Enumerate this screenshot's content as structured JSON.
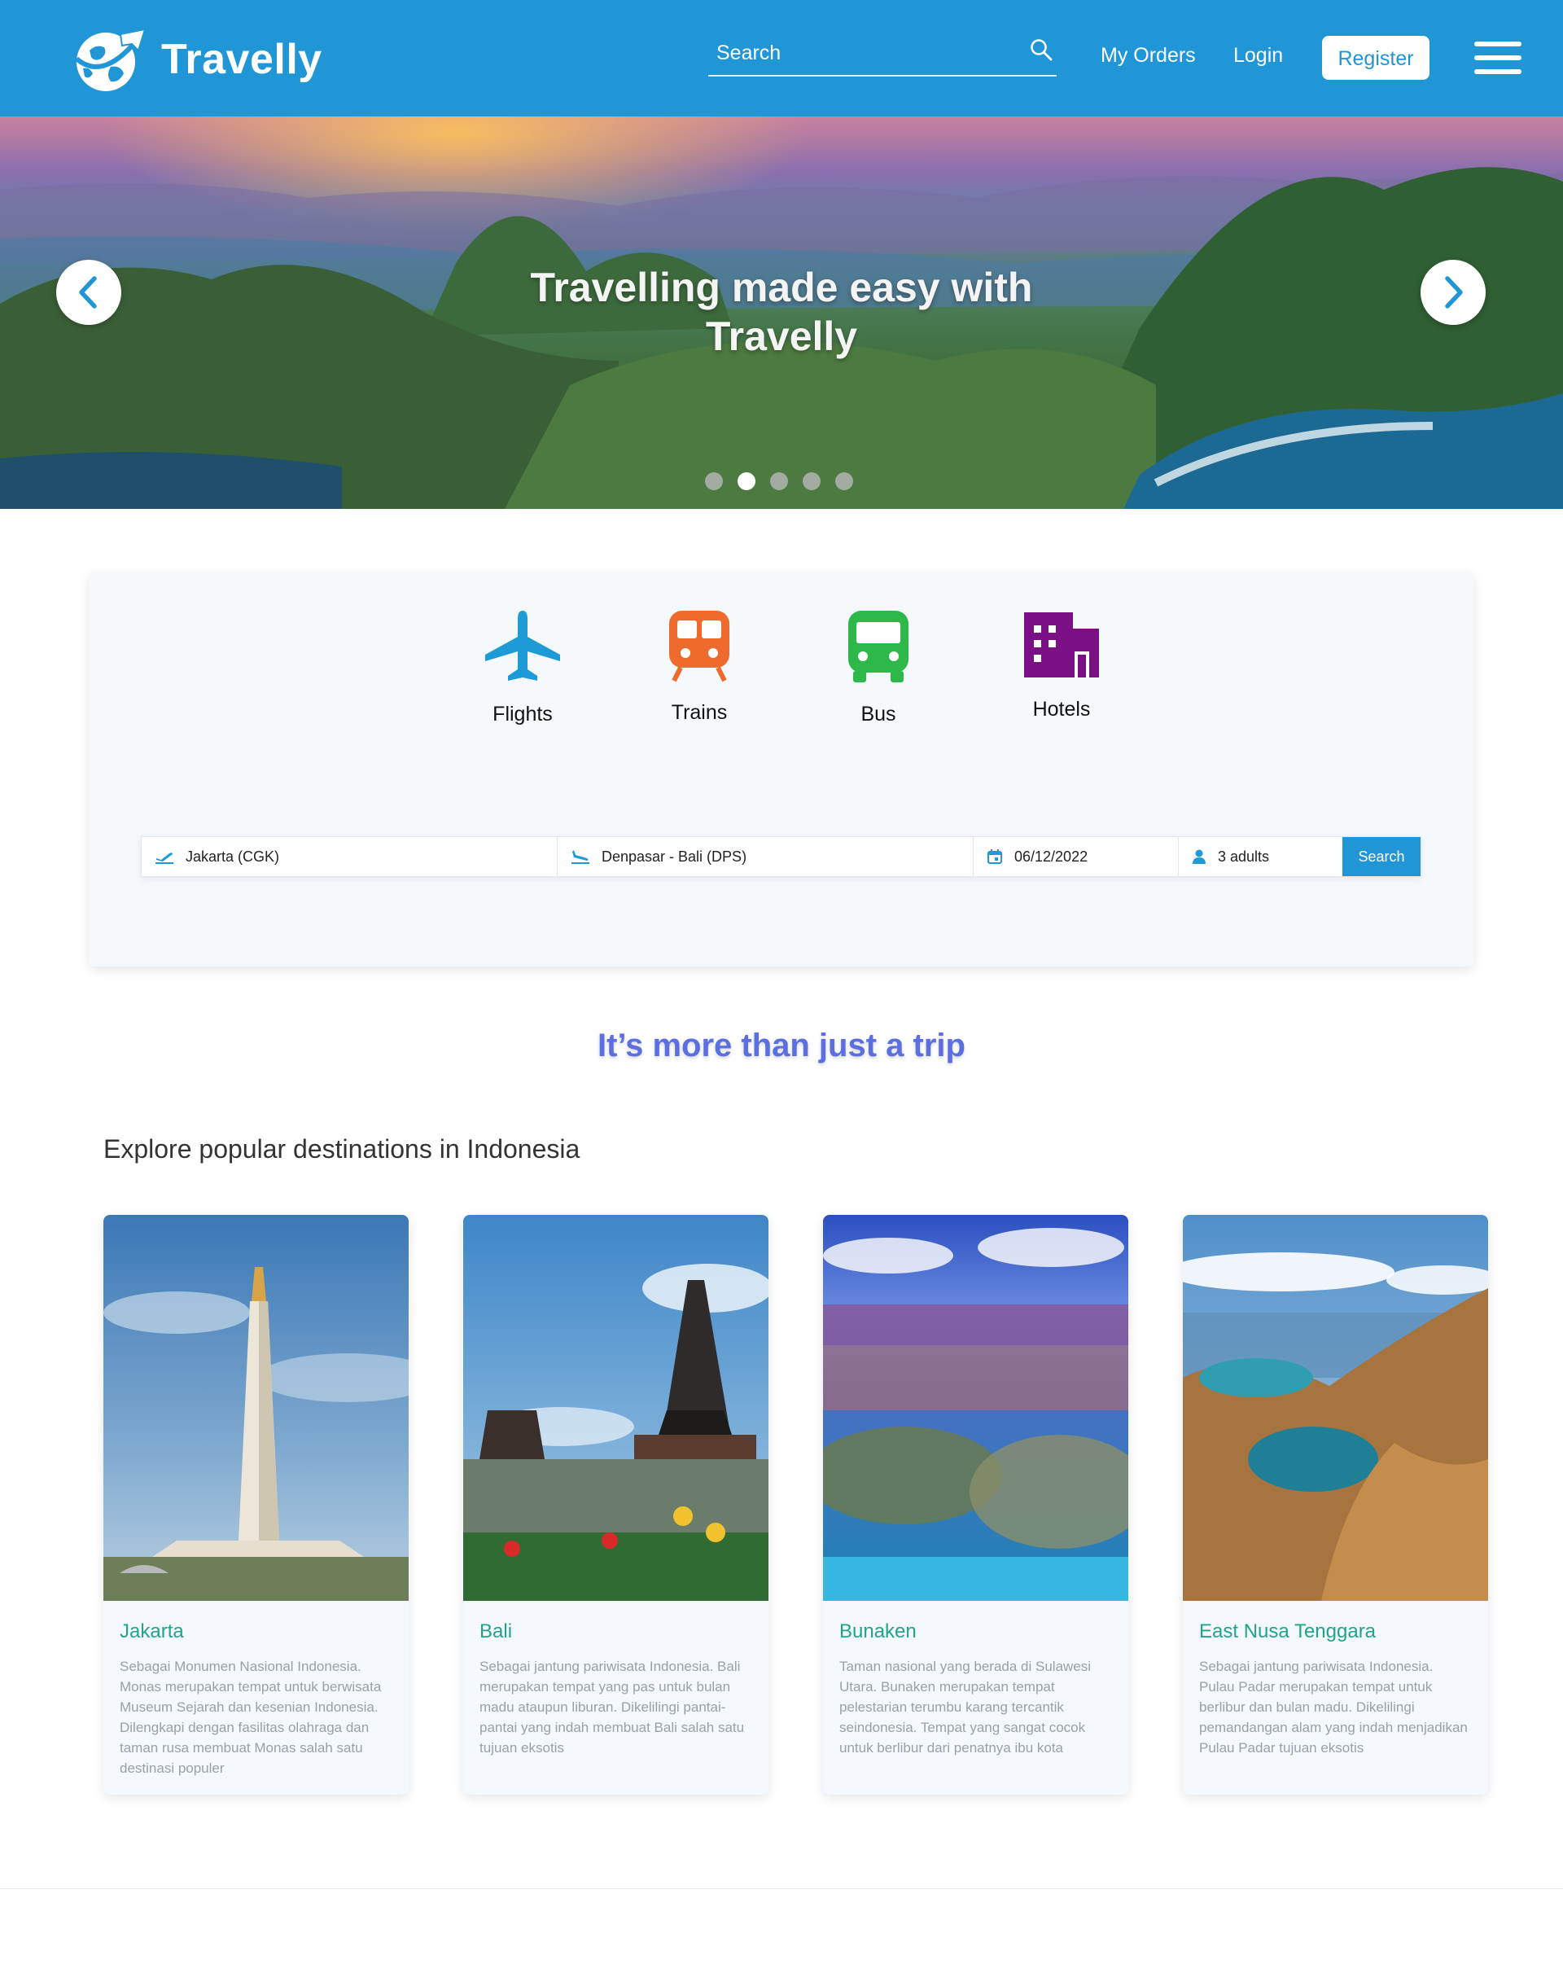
{
  "header": {
    "brand": "Travelly",
    "search_placeholder": "Search",
    "nav": {
      "orders": "My Orders",
      "login": "Login",
      "register": "Register"
    },
    "color": "#2196d6"
  },
  "hero": {
    "title": "Travelling made easy with Travelly",
    "slide_count": 5,
    "active_slide": 2
  },
  "modes": {
    "flights": "Flights",
    "trains": "Trains",
    "bus": "Bus",
    "hotels": "Hotels"
  },
  "booking": {
    "from": "Jakarta (CGK)",
    "to": "Denpasar - Bali (DPS)",
    "date": "06/12/2022",
    "passengers": "3 adults",
    "search_label": "Search"
  },
  "tagline": "It’s more than just a trip",
  "section_title": "Explore popular destinations in Indonesia",
  "destinations": [
    {
      "name": "Jakarta",
      "desc": "Sebagai Monumen Nasional Indonesia. Monas merupakan tempat untuk berwisata Museum Sejarah dan kesenian Indonesia. Dilengkapi dengan fasilitas olahraga dan taman rusa membuat Monas salah satu destinasi populer"
    },
    {
      "name": "Bali",
      "desc": "Sebagai jantung pariwisata Indonesia. Bali merupakan tempat yang pas untuk bulan madu ataupun liburan. Dikelilingi pantai-pantai yang indah membuat Bali salah satu tujuan eksotis"
    },
    {
      "name": "Bunaken",
      "desc": "Taman nasional yang berada di Sulawesi Utara. Bunaken merupakan tempat pelestarian terumbu karang tercantik seindonesia. Tempat yang sangat cocok untuk berlibur dari penatnya ibu kota"
    },
    {
      "name": "East Nusa Tenggara",
      "desc": "Sebagai jantung pariwisata Indonesia. Pulau Padar merupakan tempat untuk berlibur dan bulan madu. Dikelilingi pemandangan alam yang indah menjadikan Pulau Padar tujuan eksotis"
    }
  ],
  "colors": {
    "primary": "#2196d6",
    "flights_icon": "#1e9bd7",
    "trains_icon": "#ee6a2d",
    "bus_icon": "#2eb84a",
    "hotels_icon": "#7a0f86",
    "card_title": "#1ea58a",
    "tagline": "#5b6fe0"
  }
}
